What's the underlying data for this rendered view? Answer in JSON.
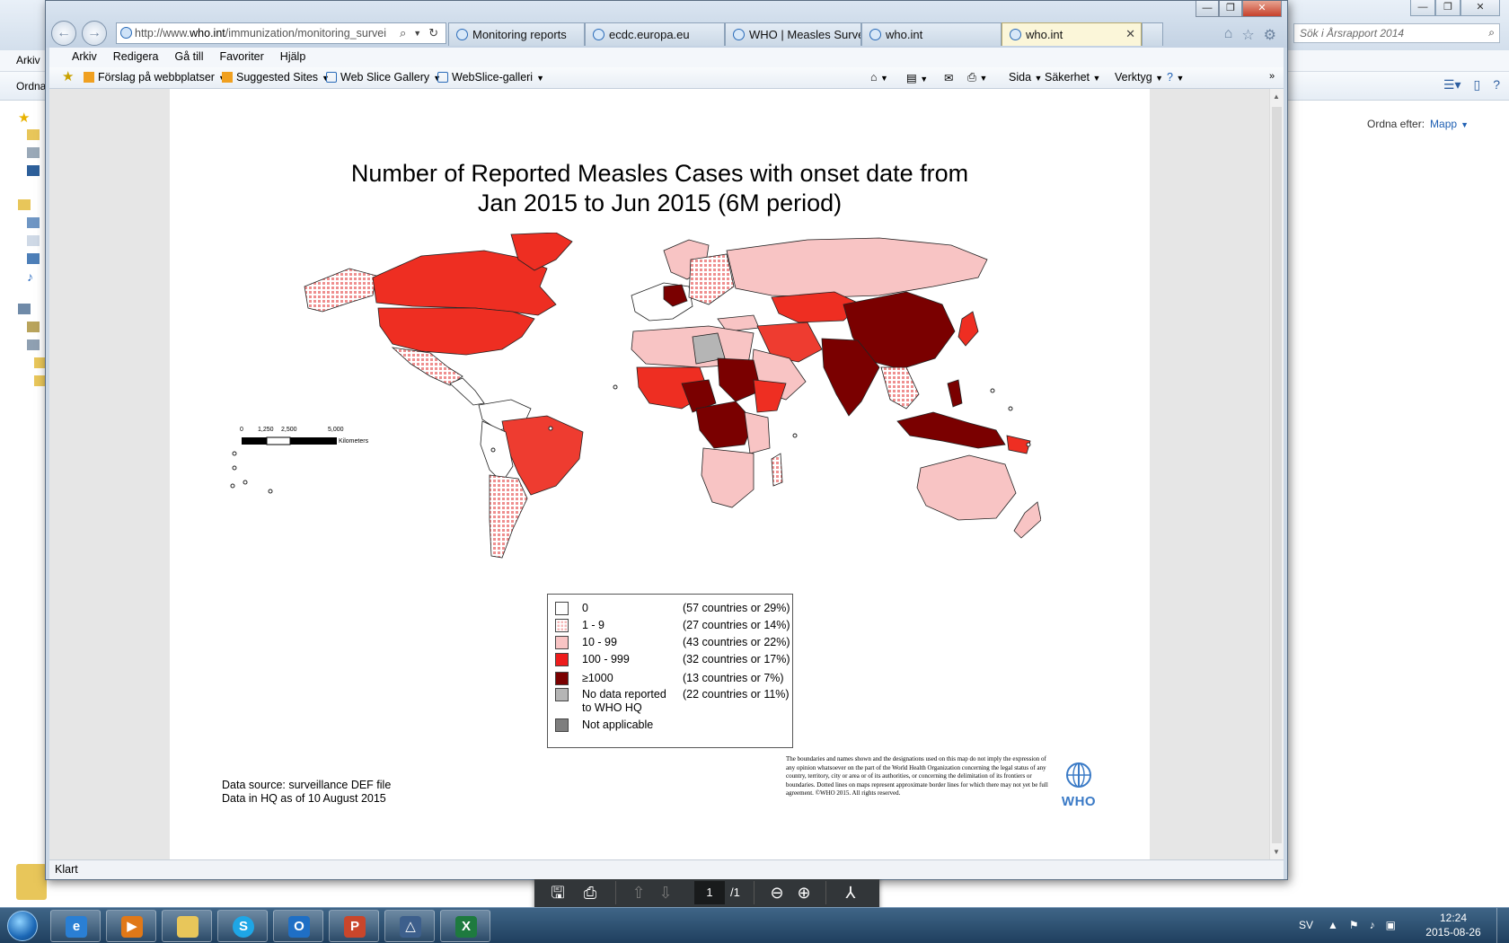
{
  "explorer": {
    "menu_arkiv": "Arkiv",
    "cmd_ordna": "Ordna",
    "search_placeholder": "Sök i Årsrapport 2014",
    "sort_label": "Ordna efter:",
    "sort_value": "Mapp"
  },
  "browser": {
    "address_prefix": "http://www.",
    "address_domain": "who.int",
    "address_rest": "/immunization/monitoring_survei",
    "tabs": [
      {
        "label": "Monitoring reports"
      },
      {
        "label": "ecdc.europa.eu"
      },
      {
        "label": "WHO | Measles Surveill..."
      },
      {
        "label": "who.int"
      },
      {
        "label": "who.int"
      }
    ],
    "menu": [
      "Arkiv",
      "Redigera",
      "Gå till",
      "Favoriter",
      "Hjälp"
    ],
    "favorites": [
      "Förslag på webbplatser",
      "Suggested Sites",
      "Web Slice Gallery",
      "WebSlice-galleri"
    ],
    "commands": {
      "page": "Sida",
      "safety": "Säkerhet",
      "tools": "Verktyg"
    },
    "status": "Klart"
  },
  "map": {
    "title_line1": "Number of Reported Measles Cases with onset date from",
    "title_line2": "Jan 2015 to Jun 2015 (6M period)",
    "scale": {
      "ticks": [
        "0",
        "1,250",
        "2,500",
        "5,000"
      ],
      "unit": "Kilometers"
    },
    "legend": [
      {
        "range": "0",
        "count": "(57 countries or 29%)",
        "color": "#ffffff"
      },
      {
        "range": "1 - 9",
        "count": "(27 countries or 14%)",
        "color": "#f6b9b9"
      },
      {
        "range": "10 - 99",
        "count": "(43 countries or 22%)",
        "color": "#f8c4c4"
      },
      {
        "range": "100 - 999",
        "count": "(32 countries or 17%)",
        "color": "#ee1c1c"
      },
      {
        "range": "≥1000",
        "count": "(13 countries or 7%)",
        "color": "#7a0000"
      },
      {
        "range_line1": "No data reported",
        "range_line2": "to WHO HQ",
        "count": "(22 countries or 11%)",
        "color": "#b5b5b5"
      },
      {
        "range": "Not applicable",
        "count": "",
        "color": "#7e7e7e"
      }
    ],
    "source_line1": "Data source: surveillance DEF file",
    "source_line2": "Data in HQ as of 10 August 2015",
    "disclaimer": "The boundaries and names shown and the designations used on this map do not imply the expression of any opinion whatsoever on the part of the World Health Organization concerning the legal status of any country, territory, city or area or of its authorities, or concerning the delimitation of its frontiers or boundaries. Dotted lines on maps represent approximate border lines for which there may not yet be full agreement. ©WHO 2015. All rights reserved.",
    "who_logo_text": "WHO"
  },
  "pdf_toolbar": {
    "page_number": "1",
    "page_total": "/1"
  },
  "taskbar": {
    "language": "SV",
    "time": "12:24",
    "date": "2015-08-26"
  }
}
